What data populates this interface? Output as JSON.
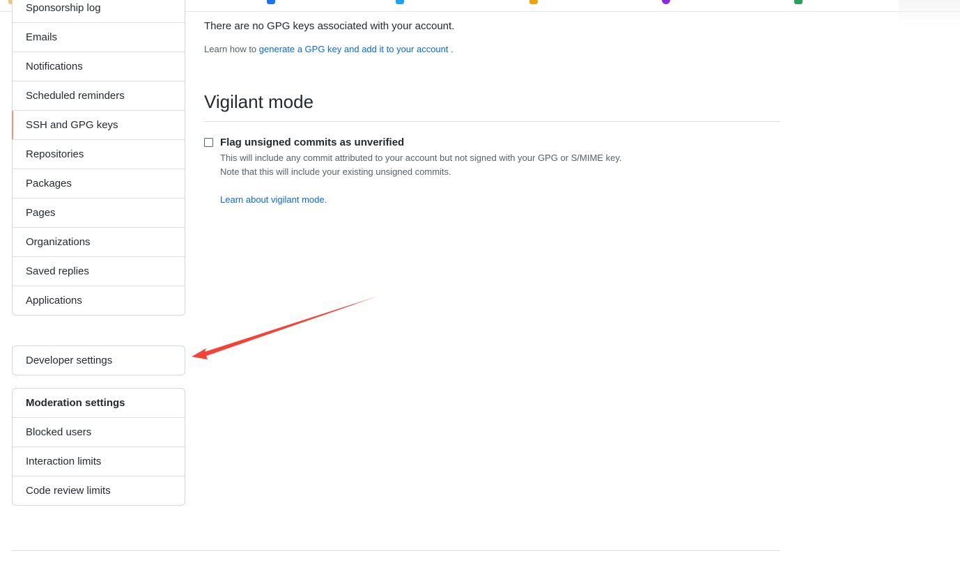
{
  "sidebar": {
    "top_menu": [
      {
        "label": "Sponsorship log",
        "selected": false
      },
      {
        "label": "Emails",
        "selected": false
      },
      {
        "label": "Notifications",
        "selected": false
      },
      {
        "label": "Scheduled reminders",
        "selected": false
      },
      {
        "label": "SSH and GPG keys",
        "selected": true
      },
      {
        "label": "Repositories",
        "selected": false
      },
      {
        "label": "Packages",
        "selected": false
      },
      {
        "label": "Pages",
        "selected": false
      },
      {
        "label": "Organizations",
        "selected": false
      },
      {
        "label": "Saved replies",
        "selected": false
      },
      {
        "label": "Applications",
        "selected": false
      }
    ],
    "developer_menu": {
      "label": "Developer settings"
    },
    "moderation_menu": {
      "heading": "Moderation settings",
      "items": [
        "Blocked users",
        "Interaction limits",
        "Code review limits"
      ]
    },
    "selected_accent_color": "#fd8c73"
  },
  "main": {
    "no_keys_text": "There are no GPG keys associated with your account.",
    "learn_how": {
      "prefix": "Learn how to ",
      "link": "generate a GPG key and add it to your account",
      "suffix": " ."
    },
    "vigilant": {
      "title": "Vigilant mode",
      "checkbox_label": "Flag unsigned commits as unverified",
      "checked": false,
      "note_line1": "This will include any commit attributed to your account but not signed with your GPG or S/MIME key.",
      "note_line2": "Note that this will include your existing unsigned commits.",
      "learn_link": "Learn about vigilant mode."
    },
    "link_color": "#0969da"
  },
  "annotation": {
    "color": "#f44336",
    "type": "arrow"
  }
}
